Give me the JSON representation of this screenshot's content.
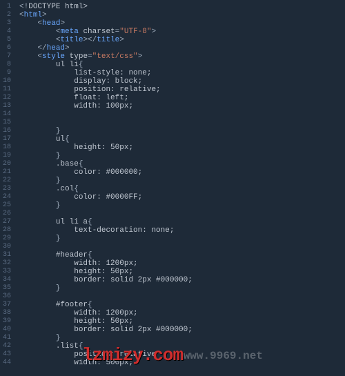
{
  "watermark": {
    "red": "lzmizy.com",
    "gray": "www.9969.net"
  },
  "code_lines": [
    [
      [
        "punc",
        "<!"
      ],
      [
        "text",
        "DOCTYPE html>"
      ]
    ],
    [
      [
        "punc",
        "<"
      ],
      [
        "tag",
        "html"
      ],
      [
        "punc",
        ">"
      ]
    ],
    [
      [
        "text",
        "    "
      ],
      [
        "punc",
        "<"
      ],
      [
        "tag",
        "head"
      ],
      [
        "punc",
        ">"
      ]
    ],
    [
      [
        "text",
        "        "
      ],
      [
        "punc",
        "<"
      ],
      [
        "tag",
        "meta"
      ],
      [
        "text",
        " "
      ],
      [
        "attr",
        "charset"
      ],
      [
        "punc",
        "="
      ],
      [
        "str",
        "\"UTF-8\""
      ],
      [
        "punc",
        ">"
      ]
    ],
    [
      [
        "text",
        "        "
      ],
      [
        "punc",
        "<"
      ],
      [
        "tag",
        "title"
      ],
      [
        "punc",
        "></"
      ],
      [
        "tag",
        "title"
      ],
      [
        "punc",
        ">"
      ]
    ],
    [
      [
        "text",
        "    "
      ],
      [
        "punc",
        "</"
      ],
      [
        "tag",
        "head"
      ],
      [
        "punc",
        ">"
      ]
    ],
    [
      [
        "text",
        "    "
      ],
      [
        "punc",
        "<"
      ],
      [
        "tag",
        "style"
      ],
      [
        "text",
        " "
      ],
      [
        "attr",
        "type"
      ],
      [
        "punc",
        "="
      ],
      [
        "str",
        "\"text/css\""
      ],
      [
        "punc",
        ">"
      ]
    ],
    [
      [
        "text",
        "        "
      ],
      [
        "sel",
        "ul li"
      ],
      [
        "punc",
        "{"
      ]
    ],
    [
      [
        "text",
        "            "
      ],
      [
        "prop",
        "list-style: none;"
      ]
    ],
    [
      [
        "text",
        "            "
      ],
      [
        "prop",
        "display: block;"
      ]
    ],
    [
      [
        "text",
        "            "
      ],
      [
        "prop",
        "position: relative;"
      ]
    ],
    [
      [
        "text",
        "            "
      ],
      [
        "prop",
        "float: left;"
      ]
    ],
    [
      [
        "text",
        "            "
      ],
      [
        "prop",
        "width: 100px;"
      ]
    ],
    [
      [
        "text",
        ""
      ]
    ],
    [
      [
        "text",
        ""
      ]
    ],
    [
      [
        "text",
        "        "
      ],
      [
        "punc",
        "}"
      ]
    ],
    [
      [
        "text",
        "        "
      ],
      [
        "sel",
        "ul"
      ],
      [
        "punc",
        "{"
      ]
    ],
    [
      [
        "text",
        "            "
      ],
      [
        "prop",
        "height: 50px;"
      ]
    ],
    [
      [
        "text",
        "        "
      ],
      [
        "punc",
        "}"
      ]
    ],
    [
      [
        "text",
        "        "
      ],
      [
        "sel",
        ".base"
      ],
      [
        "punc",
        "{"
      ]
    ],
    [
      [
        "text",
        "            "
      ],
      [
        "prop",
        "color: #000000;"
      ]
    ],
    [
      [
        "text",
        "        "
      ],
      [
        "punc",
        "}"
      ]
    ],
    [
      [
        "text",
        "        "
      ],
      [
        "sel",
        ".col"
      ],
      [
        "punc",
        "{"
      ]
    ],
    [
      [
        "text",
        "            "
      ],
      [
        "prop",
        "color: #0000FF;"
      ]
    ],
    [
      [
        "text",
        "        "
      ],
      [
        "punc",
        "}"
      ]
    ],
    [
      [
        "text",
        ""
      ]
    ],
    [
      [
        "text",
        "        "
      ],
      [
        "sel",
        "ul li a"
      ],
      [
        "punc",
        "{"
      ]
    ],
    [
      [
        "text",
        "            "
      ],
      [
        "prop",
        "text-decoration: none;"
      ]
    ],
    [
      [
        "text",
        "        "
      ],
      [
        "punc",
        "}"
      ]
    ],
    [
      [
        "text",
        ""
      ]
    ],
    [
      [
        "text",
        "        "
      ],
      [
        "sel",
        "#header"
      ],
      [
        "punc",
        "{"
      ]
    ],
    [
      [
        "text",
        "            "
      ],
      [
        "prop",
        "width: 1200px;"
      ]
    ],
    [
      [
        "text",
        "            "
      ],
      [
        "prop",
        "height: 50px;"
      ]
    ],
    [
      [
        "text",
        "            "
      ],
      [
        "prop",
        "border: solid 2px #000000;"
      ]
    ],
    [
      [
        "text",
        "        "
      ],
      [
        "punc",
        "}"
      ]
    ],
    [
      [
        "text",
        ""
      ]
    ],
    [
      [
        "text",
        "        "
      ],
      [
        "sel",
        "#footer"
      ],
      [
        "punc",
        "{"
      ]
    ],
    [
      [
        "text",
        "            "
      ],
      [
        "prop",
        "width: 1200px;"
      ]
    ],
    [
      [
        "text",
        "            "
      ],
      [
        "prop",
        "height: 50px;"
      ]
    ],
    [
      [
        "text",
        "            "
      ],
      [
        "prop",
        "border: solid 2px #000000;"
      ]
    ],
    [
      [
        "text",
        "        "
      ],
      [
        "punc",
        "}"
      ]
    ],
    [
      [
        "text",
        "        "
      ],
      [
        "sel",
        ".list"
      ],
      [
        "punc",
        "{"
      ]
    ],
    [
      [
        "text",
        "            "
      ],
      [
        "prop",
        "position: relative"
      ]
    ],
    [
      [
        "text",
        "            "
      ],
      [
        "prop",
        "width: 500px;"
      ]
    ]
  ]
}
